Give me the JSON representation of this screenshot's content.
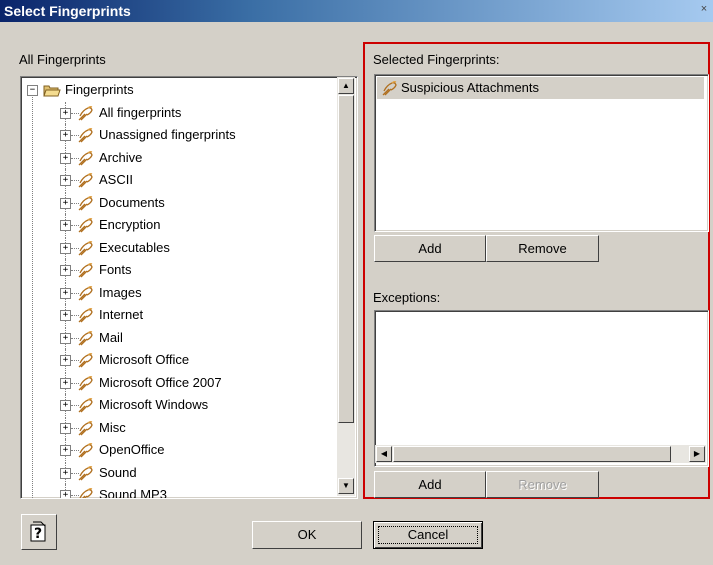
{
  "window": {
    "title": "Select Fingerprints",
    "close_glyph": "×"
  },
  "left_panel": {
    "label": "All Fingerprints",
    "root": "Fingerprints",
    "items": [
      "All fingerprints",
      "Unassigned fingerprints",
      "Archive",
      "ASCII",
      "Documents",
      "Encryption",
      "Executables",
      "Fonts",
      "Images",
      "Internet",
      "Mail",
      "Microsoft Office",
      "Microsoft Office 2007",
      "Microsoft Windows",
      "Misc",
      "OpenOffice",
      "Sound",
      "Sound MP3"
    ]
  },
  "selected_panel": {
    "label": "Selected Fingerprints:",
    "items": [
      "Suspicious Attachments"
    ],
    "add_label": "Add",
    "remove_label": "Remove"
  },
  "exceptions_panel": {
    "label": "Exceptions:",
    "add_label": "Add",
    "remove_label": "Remove"
  },
  "footer": {
    "help_icon": "help-icon",
    "ok_label": "OK",
    "cancel_label": "Cancel"
  },
  "colors": {
    "highlight_frame": "#cc0000",
    "title_bar": "#0a246a"
  }
}
